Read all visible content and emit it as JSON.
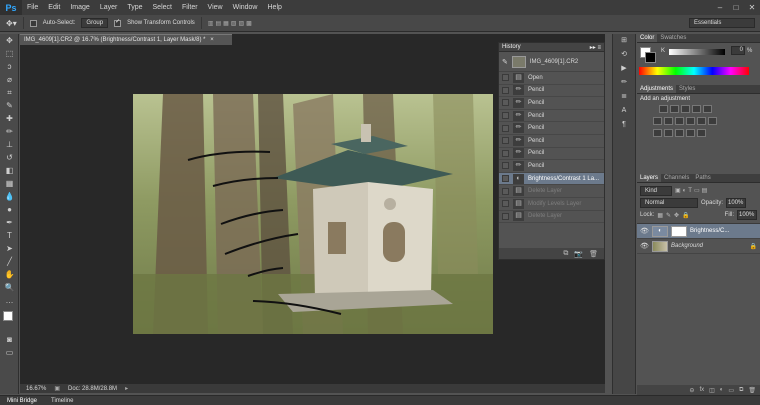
{
  "app": {
    "logo": "Ps"
  },
  "menu": [
    "File",
    "Edit",
    "Image",
    "Layer",
    "Type",
    "Select",
    "Filter",
    "View",
    "Window",
    "Help"
  ],
  "window_controls": [
    "–",
    "□",
    "✕"
  ],
  "options": {
    "auto_select_label": "Auto-Select:",
    "auto_select_value": "Group",
    "show_transform_label": "Show Transform Controls",
    "workspace": "Essentials"
  },
  "document": {
    "tab_title": "IMG_4609[1].CR2 @ 16.7% (Brightness/Contrast 1, Layer Mask/8) *",
    "zoom": "16.67%",
    "doc_size": "Doc: 28.8M/28.8M"
  },
  "bottom_tabs": [
    "Mini Bridge",
    "Timeline"
  ],
  "history": {
    "title": "History",
    "snapshot": "IMG_4609[1].CR2",
    "items": [
      {
        "label": "Open",
        "icon": "open-icon",
        "state": "normal"
      },
      {
        "label": "Pencil",
        "icon": "pencil-icon",
        "state": "normal"
      },
      {
        "label": "Pencil",
        "icon": "pencil-icon",
        "state": "normal"
      },
      {
        "label": "Pencil",
        "icon": "pencil-icon",
        "state": "normal"
      },
      {
        "label": "Pencil",
        "icon": "pencil-icon",
        "state": "normal"
      },
      {
        "label": "Pencil",
        "icon": "pencil-icon",
        "state": "normal"
      },
      {
        "label": "Pencil",
        "icon": "pencil-icon",
        "state": "normal"
      },
      {
        "label": "Pencil",
        "icon": "pencil-icon",
        "state": "normal"
      },
      {
        "label": "Brightness/Contrast 1 La...",
        "icon": "adjustment-icon",
        "state": "selected"
      },
      {
        "label": "Delete Layer",
        "icon": "layer-icon",
        "state": "dim"
      },
      {
        "label": "Modify Levels Layer",
        "icon": "layer-icon",
        "state": "dim"
      },
      {
        "label": "Delete Layer",
        "icon": "layer-icon",
        "state": "dim"
      }
    ]
  },
  "color_panel": {
    "tabs": [
      "Color",
      "Swatches"
    ],
    "channel": "K",
    "value": "0",
    "unit": "%"
  },
  "adjustments_panel": {
    "tabs": [
      "Adjustments",
      "Styles"
    ],
    "heading": "Add an adjustment"
  },
  "layers_panel": {
    "tabs": [
      "Layers",
      "Channels",
      "Paths"
    ],
    "kind": "Kind",
    "blend_mode": "Normal",
    "opacity_label": "Opacity:",
    "opacity_value": "100%",
    "lock_label": "Lock:",
    "fill_label": "Fill:",
    "fill_value": "100%",
    "layers": [
      {
        "name": "Brightness/C...",
        "selected": true
      },
      {
        "name": "Background",
        "selected": false
      }
    ]
  },
  "colors": {
    "accent": "#31a8ff",
    "selection": "#6c7a8c"
  }
}
